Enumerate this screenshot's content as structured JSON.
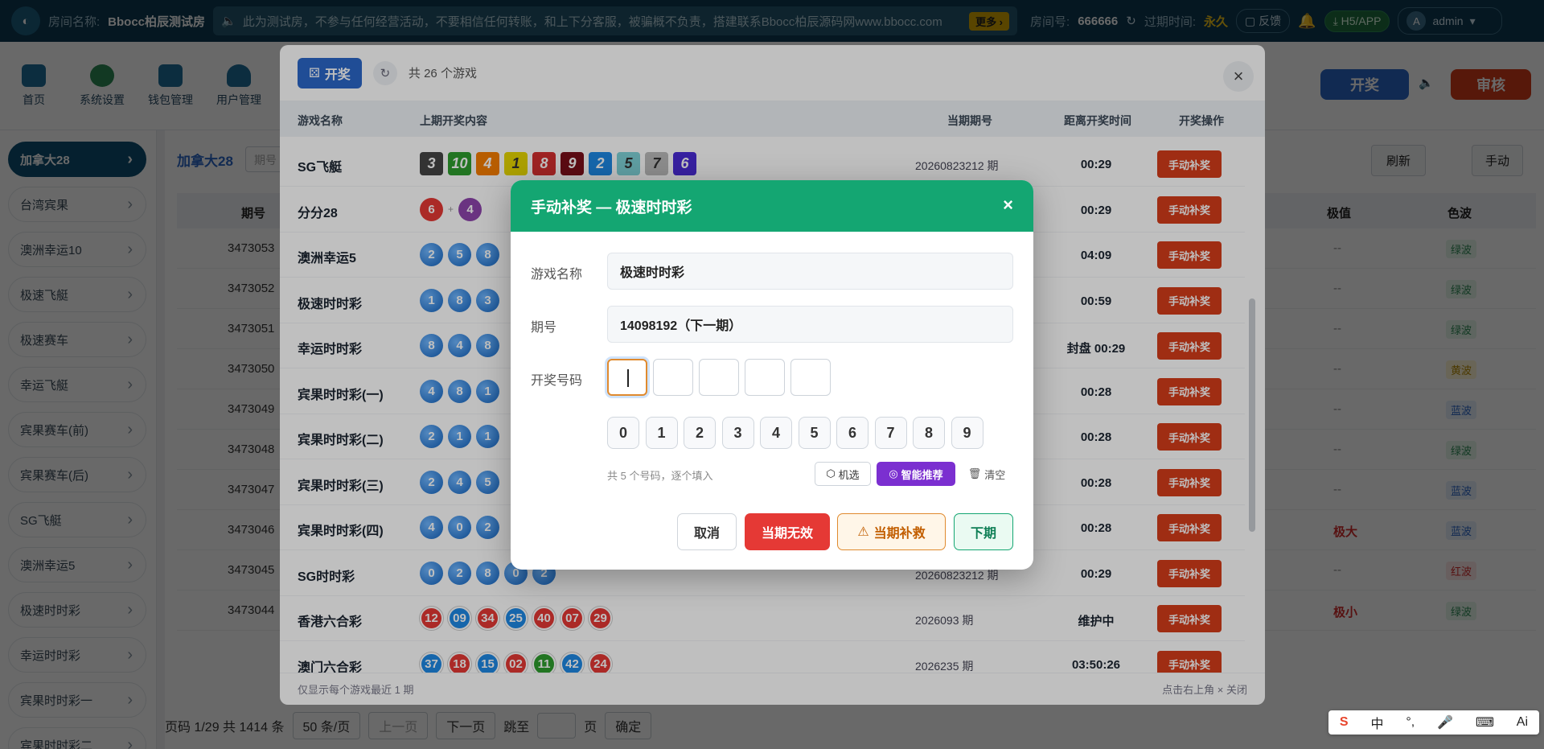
{
  "topbar": {
    "room_label": "房间名称:",
    "room_name": "Bbocc柏辰测试房",
    "notice": "此为测试房，不参与任何经营活动，不要相信任何转账，和上下分客服，被骗概不负责，搭建联系Bbocc柏辰源码网www.bbocc.com",
    "more_label": "更多 ›",
    "room_no_label": "房间号:",
    "room_no": "666666",
    "expire_label": "过期时间:",
    "expire_value": "永久",
    "feedback_label": "反馈",
    "app_label": "H5/APP",
    "user_name": "admin",
    "avatar_letter": "A"
  },
  "nav": {
    "items": [
      {
        "label": "首页"
      },
      {
        "label": "系统设置"
      },
      {
        "label": "钱包管理"
      },
      {
        "label": "用户管理"
      }
    ],
    "kj_button": "开奖",
    "audit_button": "审核"
  },
  "sidebar": {
    "items": [
      {
        "label": "加拿大28"
      },
      {
        "label": "台湾宾果"
      },
      {
        "label": "澳洲幸运10"
      },
      {
        "label": "极速飞艇"
      },
      {
        "label": "极速赛车"
      },
      {
        "label": "幸运飞艇"
      },
      {
        "label": "宾果赛车(前)"
      },
      {
        "label": "宾果赛车(后)"
      },
      {
        "label": "SG飞艇"
      },
      {
        "label": "澳洲幸运5"
      },
      {
        "label": "极速时时彩"
      },
      {
        "label": "幸运时时彩"
      },
      {
        "label": "宾果时时彩一"
      },
      {
        "label": "宾果时时彩二"
      }
    ]
  },
  "background_page": {
    "section_title": "加拿大28",
    "search_placeholder": "期号",
    "refresh_button": "刷新",
    "manual_button": "手动",
    "col_issue": "期号",
    "col_extreme": "极值",
    "col_color": "色波",
    "issues": [
      "3473053",
      "3473052",
      "3473051",
      "3473050",
      "3473049",
      "3473048",
      "3473047",
      "3473046",
      "3473045",
      "3473044"
    ],
    "color_waves": [
      "绿波",
      "绿波",
      "绿波",
      "黄波",
      "蓝波",
      "绿波",
      "蓝波",
      "蓝波",
      "红波",
      "绿波"
    ],
    "extremes": [
      "--",
      "--",
      "--",
      "--",
      "--",
      "--",
      "--",
      "极大",
      "--",
      "极小"
    ],
    "pager": {
      "info": "页码 1/29 共 1414 条",
      "page_size": "50 条/页",
      "prev": "上一页",
      "next": "下一页",
      "jump_label": "跳至",
      "page_unit": "页",
      "confirm": "确定"
    }
  },
  "draw_modal": {
    "title_button": "开奖",
    "count_text": "共 26 个游戏",
    "headers": {
      "name": "游戏名称",
      "last": "上期开奖内容",
      "issue": "当期期号",
      "time_left": "距离开奖时间",
      "op": "开奖操作"
    },
    "op_label": "手动补奖",
    "rows": [
      {
        "name": "SG飞艇",
        "style": "square",
        "numbers": [
          "3",
          "10",
          "4",
          "1",
          "8",
          "9",
          "2",
          "5",
          "7",
          "6"
        ],
        "issue": "20260823212 期",
        "time_left": "00:29"
      },
      {
        "name": "分分28",
        "style": "pc28",
        "numbers": [
          "6",
          "4"
        ],
        "issue": "",
        "time_left": "00:29"
      },
      {
        "name": "澳洲幸运5",
        "style": "blue",
        "numbers": [
          "2",
          "5",
          "8"
        ],
        "issue": "",
        "time_left": "04:09"
      },
      {
        "name": "极速时时彩",
        "style": "blue",
        "numbers": [
          "1",
          "8",
          "3"
        ],
        "issue": "",
        "time_left": "00:59"
      },
      {
        "name": "幸运时时彩",
        "style": "blue",
        "numbers": [
          "8",
          "4",
          "8"
        ],
        "issue": "",
        "time_left": "封盘 00:29"
      },
      {
        "name": "宾果时时彩(一)",
        "style": "blue",
        "numbers": [
          "4",
          "8",
          "1"
        ],
        "issue": "",
        "time_left": "00:28"
      },
      {
        "name": "宾果时时彩(二)",
        "style": "blue",
        "numbers": [
          "2",
          "1",
          "1"
        ],
        "issue": "",
        "time_left": "00:28"
      },
      {
        "name": "宾果时时彩(三)",
        "style": "blue",
        "numbers": [
          "2",
          "4",
          "5"
        ],
        "issue": "",
        "time_left": "00:28"
      },
      {
        "name": "宾果时时彩(四)",
        "style": "blue",
        "numbers": [
          "4",
          "0",
          "2"
        ],
        "issue": "",
        "time_left": "00:28"
      },
      {
        "name": "SG时时彩",
        "style": "blue",
        "numbers": [
          "0",
          "2",
          "8",
          "0",
          "2"
        ],
        "issue": "20260823212 期",
        "time_left": "00:29"
      },
      {
        "name": "香港六合彩",
        "style": "lhc",
        "numbers": [
          "12",
          "09",
          "34",
          "25",
          "40",
          "07",
          "29"
        ],
        "issue": "2026093 期",
        "time_left": "维护中"
      },
      {
        "name": "澳门六合彩",
        "style": "lhc",
        "numbers": [
          "37",
          "18",
          "15",
          "02",
          "11",
          "42",
          "24"
        ],
        "issue": "2026235 期",
        "time_left": "03:50:26"
      }
    ],
    "footer_left": "仅显示每个游戏最近 1 期",
    "footer_right": "点击右上角 × 关闭"
  },
  "reissue_dialog": {
    "title": "手动补奖 — 极速时时彩",
    "game_label": "游戏名称",
    "game_value": "极速时时彩",
    "issue_label": "期号",
    "issue_value": "14098192（下一期）",
    "numbers_label": "开奖号码",
    "slots": [
      "",
      "",
      "",
      "",
      ""
    ],
    "keypad": [
      "0",
      "1",
      "2",
      "3",
      "4",
      "5",
      "6",
      "7",
      "8",
      "9"
    ],
    "hint": "共 5 个号码，逐个填入",
    "random_button": "机选",
    "smart_button": "智能推荐",
    "clear_button": "清空",
    "cancel_button": "取消",
    "void_button": "当期无效",
    "remedy_button": "当期补救",
    "next_button": "下期"
  },
  "ime": {
    "items": [
      "中",
      "°,",
      "🎤",
      "⌨",
      "Ai"
    ]
  },
  "colors": {
    "topbar": "#0d3a52",
    "accent_green": "#14a672",
    "op_red": "#d43d1a",
    "void_red": "#e53935",
    "warn_orange": "#e08a2e"
  }
}
